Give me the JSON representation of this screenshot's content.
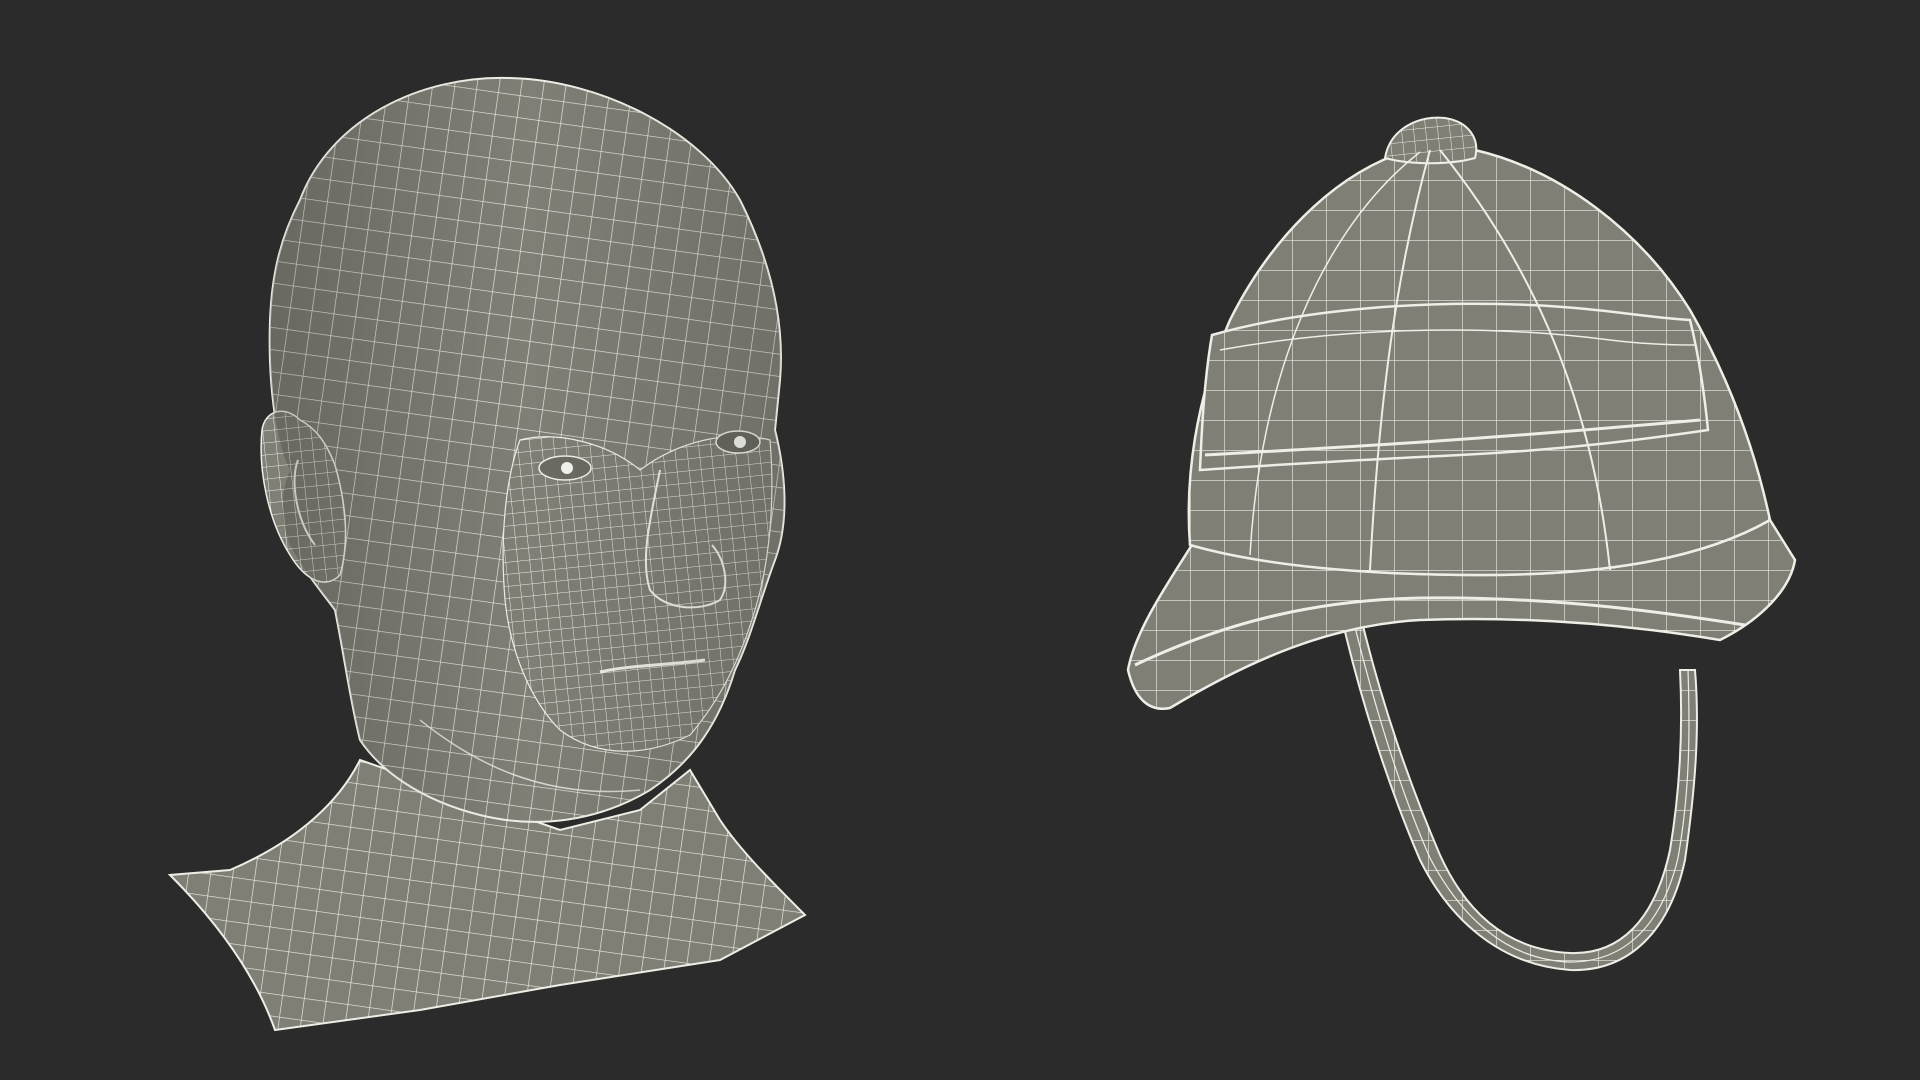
{
  "scene": {
    "background_color": "#2b2b2b",
    "mesh_fill_color": "#7f7f76",
    "mesh_shade_color": "#6b6b63",
    "wire_color": "#eeeee6",
    "objects": [
      {
        "name": "head-mesh",
        "kind": "wireframe human head"
      },
      {
        "name": "pith-helmet-mesh",
        "kind": "wireframe pith helmet with chin strap"
      }
    ]
  }
}
